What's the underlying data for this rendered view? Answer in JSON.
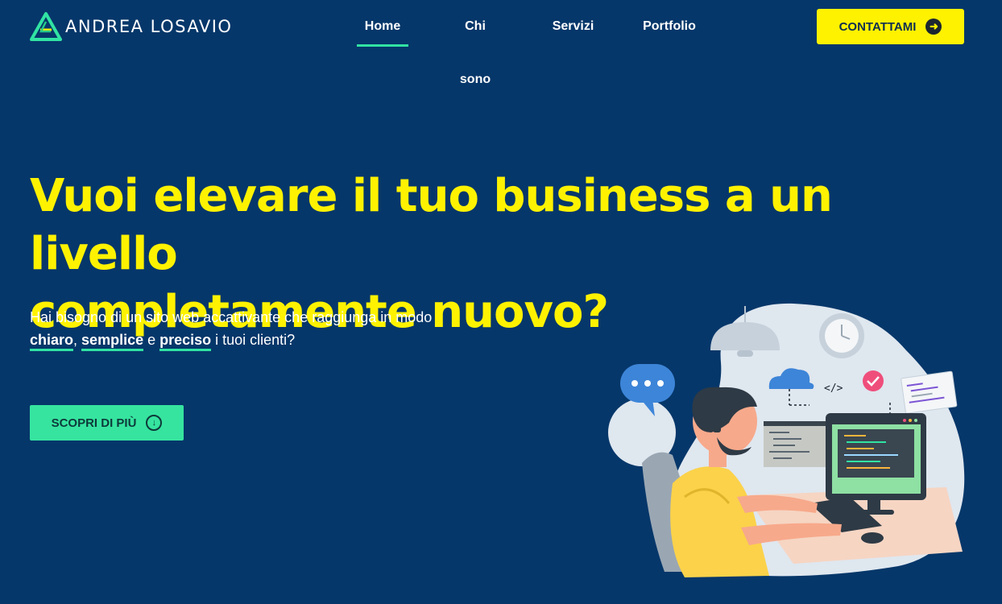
{
  "brand": {
    "name": "ANDREA LOSAVIO",
    "logo_icon": "triangle-logo-icon"
  },
  "nav": {
    "items": [
      {
        "label": "Home",
        "active": true
      },
      {
        "label": "Chi sono",
        "active": false
      },
      {
        "label": "Servizi",
        "active": false
      },
      {
        "label": "Portfolio",
        "active": false
      }
    ]
  },
  "header": {
    "cta_label": "CONTATTAMI",
    "cta_icon": "arrow-right-circle-icon"
  },
  "hero": {
    "title_line1": "Vuoi elevare il tuo business a un livello",
    "title_line2": "completamente nuovo?",
    "subtitle_line1": "Hai bisogno di un sito web accattivante che raggiunga in modo",
    "hl1": "chiaro",
    "sep1": ", ",
    "hl2": "semplice",
    "sep2": " e ",
    "hl3": "preciso",
    "subtitle_end": " i tuoi clienti?",
    "button_label": "SCOPRI DI PIÙ",
    "button_icon": "arrow-down-circle-icon"
  },
  "illustration": {
    "code_tag": "</>"
  },
  "colors": {
    "background": "#06376a",
    "accent_yellow": "#fff200",
    "accent_green": "#31e3a3"
  }
}
